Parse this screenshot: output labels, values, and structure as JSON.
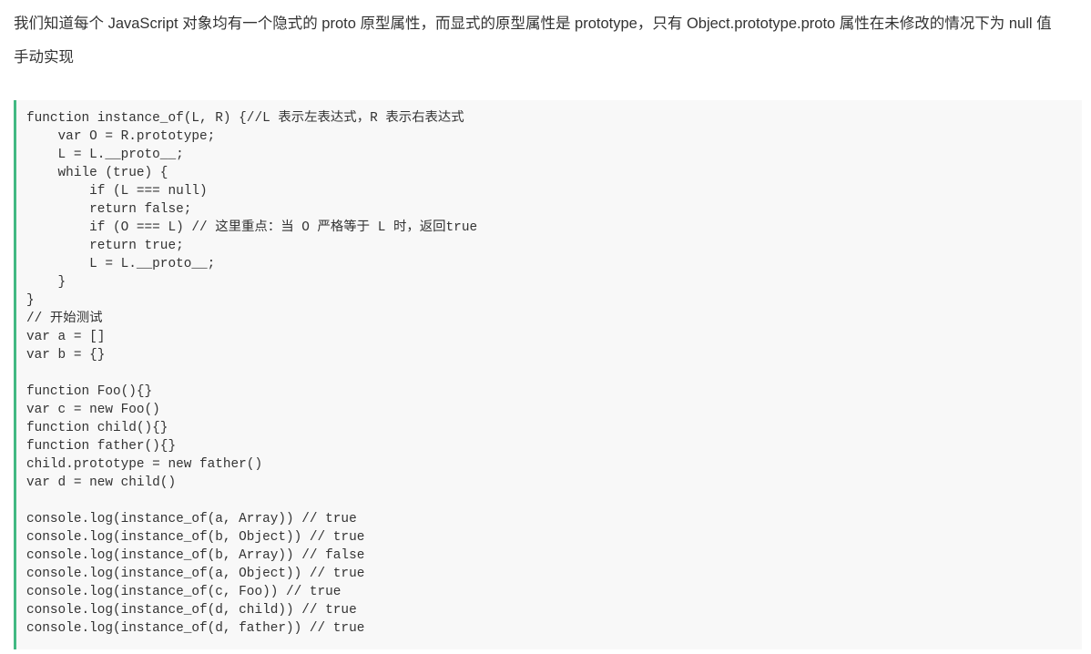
{
  "article": {
    "intro": "我们知道每个 JavaScript 对象均有一个隐式的 proto 原型属性，而显式的原型属性是 prototype，只有 Object.prototype.proto 属性在未修改的情况下为 null 值",
    "subheading": "手动实现"
  },
  "code": {
    "lines": [
      "function instance_of(L, R) {//L 表示左表达式，R 表示右表达式",
      "    var O = R.prototype;",
      "    L = L.__proto__;",
      "    while (true) {",
      "        if (L === null)",
      "        return false;",
      "        if (O === L) // 这里重点：当 O 严格等于 L 时，返回true",
      "        return true;",
      "        L = L.__proto__;",
      "    }",
      "}",
      "// 开始测试",
      "var a = []",
      "var b = {}",
      "",
      "function Foo(){}",
      "var c = new Foo()",
      "function child(){}",
      "function father(){}",
      "child.prototype = new father()",
      "var d = new child()",
      "",
      "console.log(instance_of(a, Array)) // true",
      "console.log(instance_of(b, Object)) // true",
      "console.log(instance_of(b, Array)) // false",
      "console.log(instance_of(a, Object)) // true",
      "console.log(instance_of(c, Foo)) // true",
      "console.log(instance_of(d, child)) // true",
      "console.log(instance_of(d, father)) // true"
    ]
  },
  "colors": {
    "text": "#333333",
    "code_background": "#f8f8f8",
    "code_border_accent": "#42b983"
  }
}
